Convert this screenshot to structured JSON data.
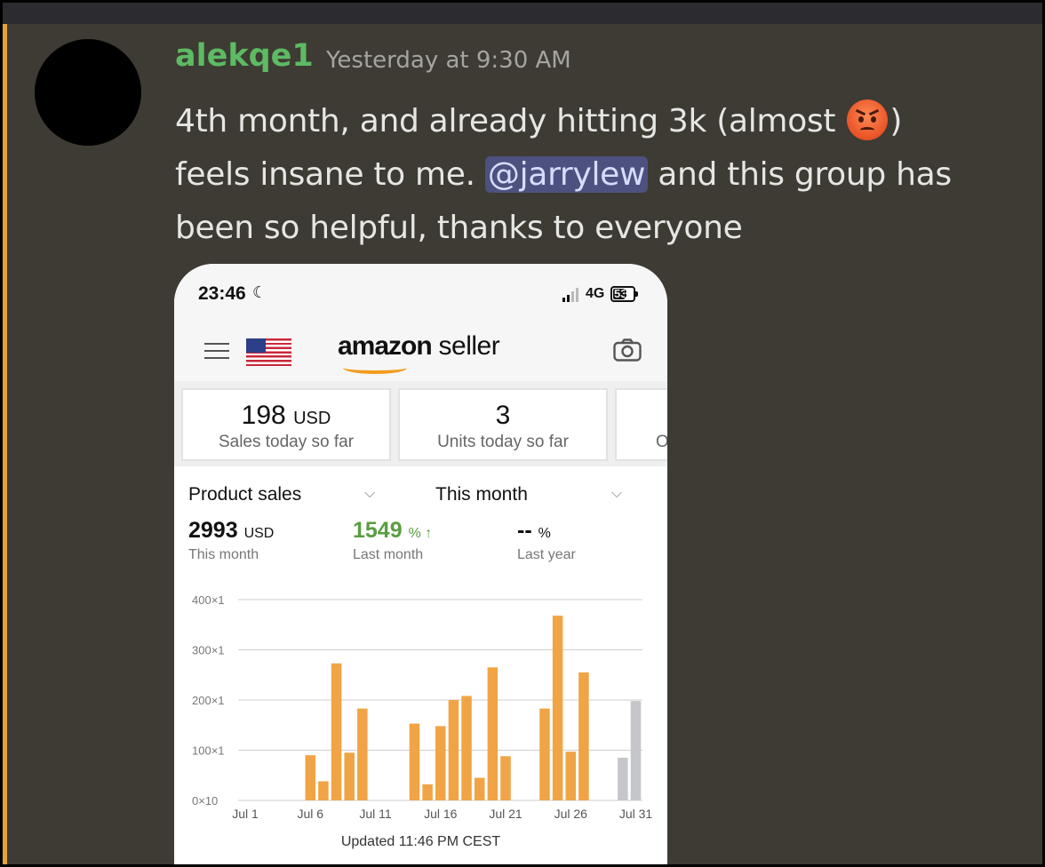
{
  "post": {
    "username": "alekqe1",
    "timestamp": "Yesterday at 9:30 AM",
    "text_before_emoji": "4th month, and already hitting 3k (almost ",
    "text_after_emoji": ")",
    "text_line2_start": "feels insane to me. ",
    "mention": "@jarrylew",
    "text_after_mention": " and this group has been so helpful, thanks to everyone",
    "emoji": "angry-face-icon",
    "accent_color": "#e6a23a",
    "username_color": "#5dbb63"
  },
  "phone": {
    "time": "23:46",
    "moon_glyph": "☾",
    "network": "4G",
    "battery": "53",
    "app_logo_amazon": "amazon",
    "app_logo_seller": " seller",
    "kpis": [
      {
        "value": "198",
        "unit": "USD",
        "label": "Sales today so far"
      },
      {
        "value": "3",
        "unit": "",
        "label": "Units today so far"
      },
      {
        "value": "",
        "unit": "",
        "label": "O"
      }
    ],
    "filter_metric": "Product sales",
    "filter_period": "This month",
    "stats": [
      {
        "value": "2993",
        "unit": "USD",
        "label": "This month"
      },
      {
        "value": "1549",
        "unit": "%",
        "label": "Last month"
      },
      {
        "value": "--",
        "unit": "%",
        "label": "Last year"
      }
    ],
    "footer": "Updated 11:46 PM CEST"
  },
  "chart_data": {
    "type": "bar",
    "ytick_labels": [
      "400×1",
      "300×1",
      "200×1",
      "100×1",
      "0×10"
    ],
    "ylim": [
      0,
      400
    ],
    "xtick_labels": [
      "Jul 1",
      "Jul 6",
      "Jul 11",
      "Jul 16",
      "Jul 21",
      "Jul 26",
      "Jul 31"
    ],
    "xtick_days": [
      1,
      6,
      11,
      16,
      21,
      26,
      31
    ],
    "days": [
      1,
      2,
      3,
      4,
      5,
      6,
      7,
      8,
      9,
      10,
      11,
      12,
      13,
      14,
      15,
      16,
      17,
      18,
      19,
      20,
      21,
      22,
      23,
      24,
      25,
      26,
      27,
      28,
      29,
      30,
      31
    ],
    "values": [
      0,
      0,
      0,
      0,
      0,
      90,
      38,
      273,
      95,
      183,
      0,
      0,
      0,
      153,
      32,
      148,
      200,
      208,
      45,
      265,
      88,
      0,
      0,
      183,
      368,
      97,
      255,
      0,
      0,
      85,
      198
    ],
    "colors": {
      "actual": "#f0a446",
      "projected": "#c4c6ca"
    },
    "projected_days": [
      30,
      31
    ]
  }
}
